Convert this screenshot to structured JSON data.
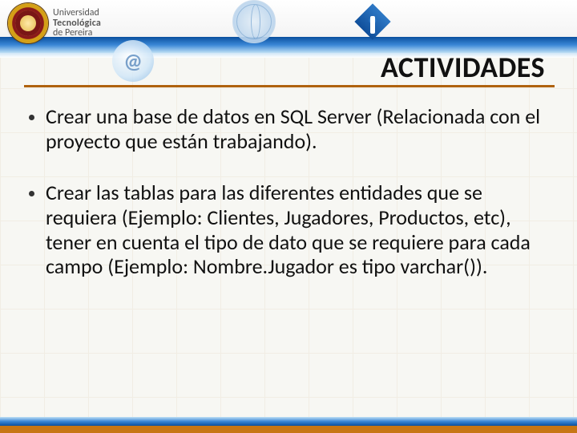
{
  "university": {
    "line1": "Universidad",
    "line2": "Tecnológica",
    "line3": "de Pereira"
  },
  "slide": {
    "title": "ACTIVIDADES",
    "bullets": [
      "Crear una base de datos en SQL Server (Relacionada con el proyecto que están trabajando).",
      "Crear las tablas para las diferentes entidades que se requiera (Ejemplo: Clientes, Jugadores, Productos, etc), tener en cuenta el tipo de dato que se requiere para cada campo (Ejemplo: Nombre.Jugador es tipo varchar())."
    ]
  },
  "decor": {
    "at_symbol": "@"
  }
}
